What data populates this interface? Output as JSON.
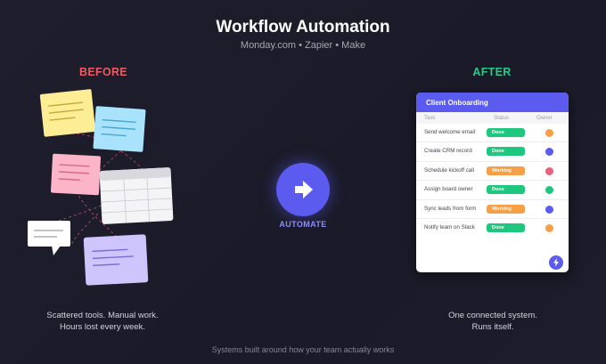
{
  "header": {
    "title": "Workflow Automation",
    "subtitle": "Monday.com • Zapier • Make"
  },
  "labels": {
    "before": "BEFORE",
    "after": "AFTER",
    "automate": "AUTOMATE"
  },
  "board": {
    "title": "Client Onboarding",
    "columns": {
      "task": "Task",
      "status": "Status",
      "owner": "Owner"
    },
    "rows": [
      {
        "task": "Send welcome email",
        "status": "Done",
        "status_color": "#1fc77e",
        "owner_color": "#f5a049"
      },
      {
        "task": "Create CRM record",
        "status": "Done",
        "status_color": "#1fc77e",
        "owner_color": "#5b5bf0"
      },
      {
        "task": "Schedule kickoff call",
        "status": "Working",
        "status_color": "#f5a049",
        "owner_color": "#e8607a"
      },
      {
        "task": "Assign board owner",
        "status": "Done",
        "status_color": "#1fc77e",
        "owner_color": "#1fc77e"
      },
      {
        "task": "Sync leads from form",
        "status": "Working",
        "status_color": "#f5a049",
        "owner_color": "#5b5bf0"
      },
      {
        "task": "Notify team on Slack",
        "status": "Done",
        "status_color": "#1fc77e",
        "owner_color": "#f5a049"
      }
    ]
  },
  "captions": {
    "before_line1": "Scattered tools. Manual work.",
    "before_line2": "Hours lost every week.",
    "after_line1": "One connected system.",
    "after_line2": "Runs itself."
  },
  "footer": "Systems built around how your team actually works",
  "colors": {
    "accent": "#5b5bf0",
    "before": "#ef5a62",
    "after": "#28c98a",
    "done": "#1fc77e",
    "working": "#f5a049"
  },
  "icons": [
    "arrow-right-icon",
    "lightning-bolt-icon"
  ]
}
